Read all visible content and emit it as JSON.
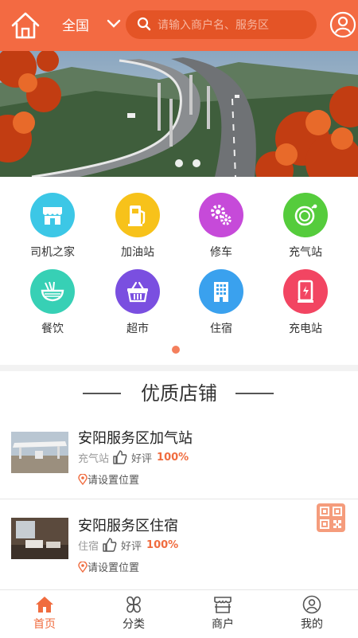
{
  "header": {
    "region": "全国",
    "search_placeholder": "请输入商户名、服务区"
  },
  "categories": [
    {
      "label": "司机之家",
      "color": "#3cc7e6",
      "icon": "storefront-icon"
    },
    {
      "label": "加油站",
      "color": "#f7c21a",
      "icon": "fuel-pump-icon"
    },
    {
      "label": "修车",
      "color": "#c64ad9",
      "icon": "gears-icon"
    },
    {
      "label": "充气站",
      "color": "#55cc3c",
      "icon": "gauge-icon"
    },
    {
      "label": "餐饮",
      "color": "#37d0b5",
      "icon": "noodle-bowl-icon"
    },
    {
      "label": "超市",
      "color": "#7a4fe0",
      "icon": "basket-icon"
    },
    {
      "label": "住宿",
      "color": "#3aa1ee",
      "icon": "building-icon"
    },
    {
      "label": "充电站",
      "color": "#f24562",
      "icon": "charging-station-icon"
    }
  ],
  "section": {
    "title": "优质店铺"
  },
  "shops": [
    {
      "name": "安阳服务区加气站",
      "category": "充气站",
      "rating_label": "好评",
      "rating": "100%",
      "location": "请设置位置"
    },
    {
      "name": "安阳服务区住宿",
      "category": "住宿",
      "rating_label": "好评",
      "rating": "100%",
      "location": "请设置位置"
    }
  ],
  "tabs": [
    {
      "label": "首页",
      "icon": "home-icon",
      "active": true
    },
    {
      "label": "分类",
      "icon": "category-icon",
      "active": false
    },
    {
      "label": "商户",
      "icon": "shop-icon",
      "active": false
    },
    {
      "label": "我的",
      "icon": "user-icon",
      "active": false
    }
  ],
  "colors": {
    "brand": "#f36a42",
    "accent": "#f06c3f"
  }
}
